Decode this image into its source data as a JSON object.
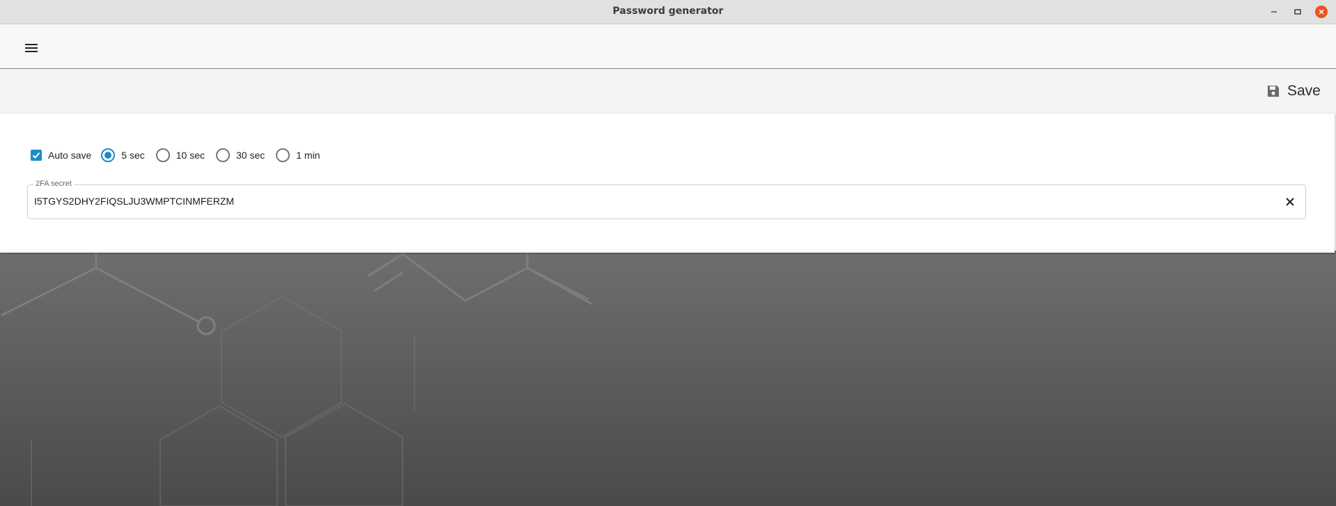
{
  "window": {
    "title": "Password generator"
  },
  "icons": {
    "menu": "hamburger-menu-icon",
    "save": "floppy-disk-icon",
    "clear": "close-x-icon",
    "minimize": "minimize-icon",
    "maximize": "maximize-icon",
    "close": "close-icon"
  },
  "colors": {
    "accent": "#1b8cc8",
    "close_button": "#e95420"
  },
  "actionbar": {
    "save_label": "Save"
  },
  "options": {
    "auto_save_label": "Auto save",
    "auto_save_checked": true,
    "intervals": [
      "5 sec",
      "10 sec",
      "30 sec",
      "1 min"
    ],
    "selected_interval": "5 sec"
  },
  "secret_field": {
    "label": "2FA secret",
    "value": "I5TGYS2DHY2FIQSLJU3WMPTCINMFERZM"
  }
}
